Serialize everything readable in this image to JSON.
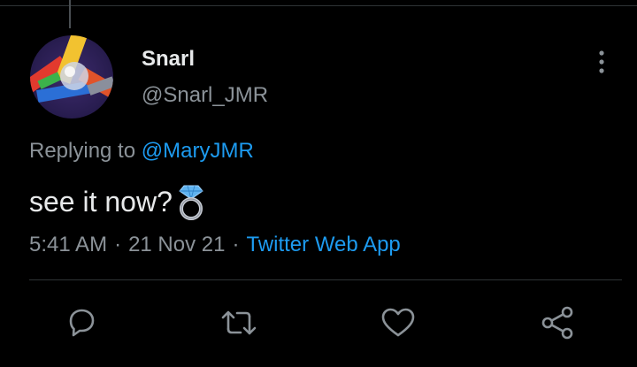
{
  "tweet": {
    "author": {
      "display_name": "Snarl",
      "handle": "@Snarl_JMR"
    },
    "reply_context": {
      "prefix": "Replying to",
      "mention": "@MaryJMR"
    },
    "text": "see it now?",
    "emoji": "ring-icon",
    "time": "5:41 AM",
    "date": "21 Nov 21",
    "source": "Twitter Web App",
    "separator": "·"
  },
  "icons": {
    "more": "more-vertical-icon",
    "reply": "reply-icon",
    "retweet": "retweet-icon",
    "like": "heart-icon",
    "share": "share-icon"
  },
  "colors": {
    "background": "#000000",
    "text_primary": "#e7e9ea",
    "text_secondary": "#8b9298",
    "accent": "#1d9bf0",
    "divider": "#2f3336"
  }
}
